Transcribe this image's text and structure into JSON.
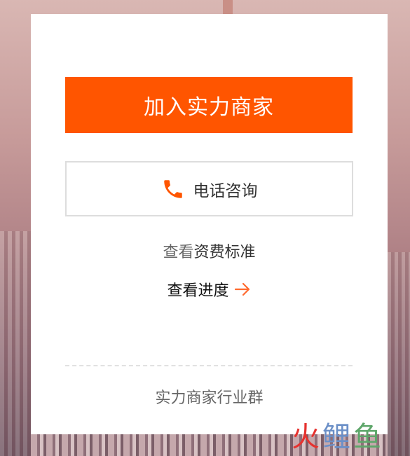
{
  "card": {
    "join_button": "加入实力商家",
    "phone_button": "电话咨询",
    "fee_link": {
      "prefix": "查看",
      "rest": "资费标准"
    },
    "progress_link": "查看进度",
    "group_link": "实力商家行业群"
  },
  "watermark": {
    "char1": "火",
    "char2": "鲤",
    "char3": "鱼"
  },
  "colors": {
    "accent": "#ff5500",
    "phone_icon": "#ff5500",
    "arrow": "#ff6a2f"
  },
  "icons": {
    "phone": "phone-icon",
    "arrow": "arrow-right-icon"
  }
}
